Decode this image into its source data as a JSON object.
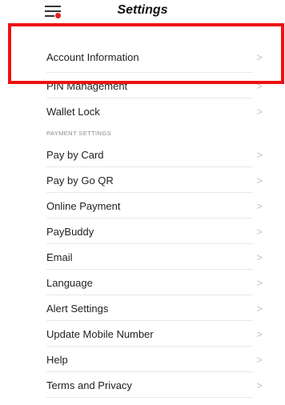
{
  "header": {
    "title": "Settings",
    "menu_icon": "menu-icon"
  },
  "colors": {
    "highlight": "#ee1111",
    "notification_dot": "#e02020",
    "chevron": "#c4c4c4"
  },
  "account": {
    "items": [
      {
        "label": "Account Information"
      },
      {
        "label": "PIN Management"
      },
      {
        "label": "Wallet Lock"
      }
    ]
  },
  "payment": {
    "section_label": "PAYMENT SETTINGS",
    "items": [
      {
        "label": "Pay by Card"
      },
      {
        "label": "Pay by Go QR"
      },
      {
        "label": "Online Payment"
      },
      {
        "label": "PayBuddy"
      },
      {
        "label": "Email"
      },
      {
        "label": "Language"
      },
      {
        "label": "Alert Settings"
      },
      {
        "label": "Update Mobile Number"
      },
      {
        "label": "Help"
      },
      {
        "label": "Terms and Privacy"
      }
    ]
  },
  "chevron_glyph": ">"
}
